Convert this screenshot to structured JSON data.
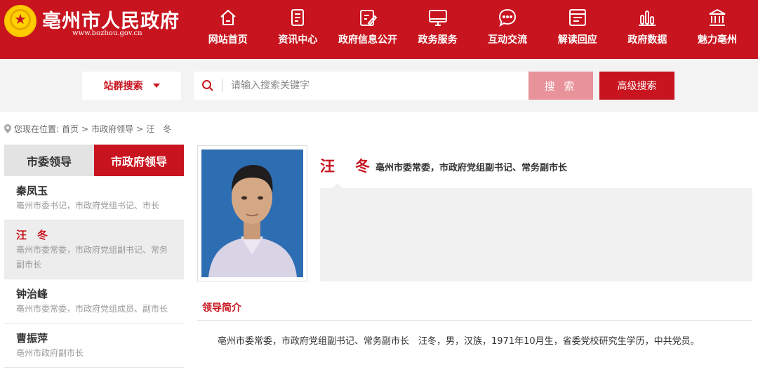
{
  "site": {
    "title": "亳州市人民政府",
    "url": "www.bozhou.gov.cn"
  },
  "nav": [
    {
      "label": "网站首页",
      "icon": "home-icon"
    },
    {
      "label": "资讯中心",
      "icon": "document-icon"
    },
    {
      "label": "政府信息公开",
      "icon": "edit-icon"
    },
    {
      "label": "政务服务",
      "icon": "monitor-icon"
    },
    {
      "label": "互动交流",
      "icon": "chat-icon"
    },
    {
      "label": "解读回应",
      "icon": "browser-icon"
    },
    {
      "label": "政府数据",
      "icon": "bar-chart-icon"
    },
    {
      "label": "魅力亳州",
      "icon": "landmark-icon"
    }
  ],
  "search": {
    "scope_label": "站群搜索",
    "placeholder": "请输入搜索关键字",
    "button_label": "搜 索",
    "advanced_label": "高级搜索"
  },
  "breadcrumb": {
    "prefix": "您现在位置:",
    "items": [
      "首页",
      "市政府领导",
      "汪　冬"
    ],
    "separator": ">"
  },
  "sidebar": {
    "tabs": [
      "市委领导",
      "市政府领导"
    ],
    "leaders": [
      {
        "name": "秦凤玉",
        "title": "亳州市委书记，市政府党组书记、市长"
      },
      {
        "name": "汪　冬",
        "title": "亳州市委常委，市政府党组副书记、常务副市长"
      },
      {
        "name": "钟治峰",
        "title": "亳州市委常委，市政府党组成员、副市长"
      },
      {
        "name": "曹振萍",
        "title": "亳州市政府副市长"
      }
    ]
  },
  "profile": {
    "name": "汪　冬",
    "title": "亳州市委常委，市政府党组副书记、常务副市长",
    "intro_heading": "领导简介",
    "intro_text": "亳州市委常委，市政府党组副书记、常务副市长　汪冬，男，汉族，1971年10月生，省委党校研究生学历，中共党员。"
  },
  "colors": {
    "brand_red": "#c8141e",
    "search_button": "#e8929a"
  }
}
